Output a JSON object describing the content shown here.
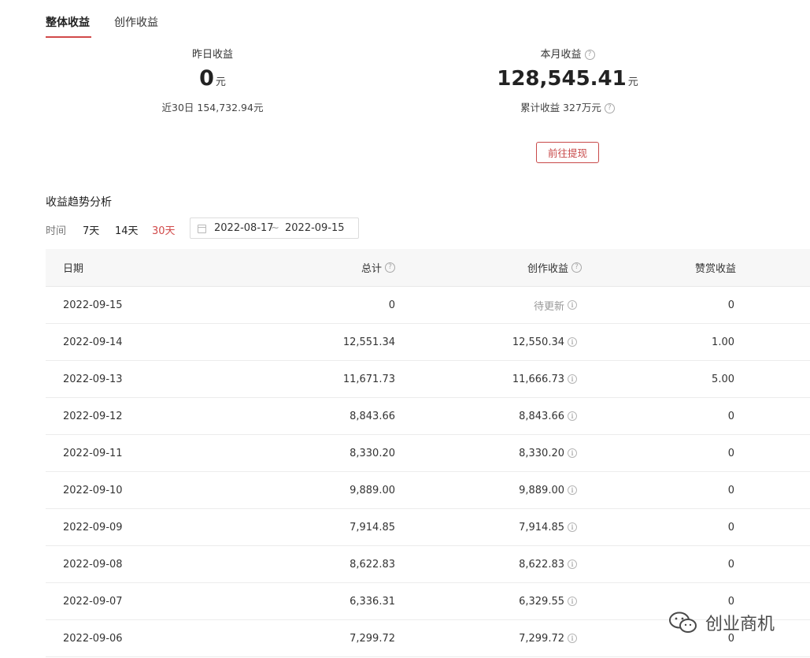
{
  "tabs": [
    {
      "label": "整体收益",
      "active": true
    },
    {
      "label": "创作收益",
      "active": false
    }
  ],
  "stats": {
    "yesterday": {
      "label": "昨日收益",
      "value": "0",
      "unit": "元",
      "sub": "近30日 154,732.94元"
    },
    "month": {
      "label": "本月收益",
      "value": "128,545.41",
      "unit": "元",
      "sub": "累计收益 327万元"
    }
  },
  "withdraw_label": "前往提现",
  "trend": {
    "title": "收益趋势分析",
    "filter_label": "时间",
    "ranges": [
      {
        "label": "7天",
        "active": false
      },
      {
        "label": "14天",
        "active": false
      },
      {
        "label": "30天",
        "active": true
      }
    ],
    "date_start": "2022-08-17",
    "date_sep": "~",
    "date_end": "2022-09-15"
  },
  "table": {
    "headers": {
      "date": "日期",
      "total": "总计",
      "create": "创作收益",
      "reward": "赞赏收益"
    },
    "rows": [
      {
        "date": "2022-09-15",
        "total": "0",
        "create": "待更新",
        "reward": "0",
        "pending": true
      },
      {
        "date": "2022-09-14",
        "total": "12,551.34",
        "create": "12,550.34",
        "reward": "1.00"
      },
      {
        "date": "2022-09-13",
        "total": "11,671.73",
        "create": "11,666.73",
        "reward": "5.00"
      },
      {
        "date": "2022-09-12",
        "total": "8,843.66",
        "create": "8,843.66",
        "reward": "0"
      },
      {
        "date": "2022-09-11",
        "total": "8,330.20",
        "create": "8,330.20",
        "reward": "0"
      },
      {
        "date": "2022-09-10",
        "total": "9,889.00",
        "create": "9,889.00",
        "reward": "0"
      },
      {
        "date": "2022-09-09",
        "total": "7,914.85",
        "create": "7,914.85",
        "reward": "0"
      },
      {
        "date": "2022-09-08",
        "total": "8,622.83",
        "create": "8,622.83",
        "reward": "0"
      },
      {
        "date": "2022-09-07",
        "total": "6,336.31",
        "create": "6,329.55",
        "reward": "0"
      },
      {
        "date": "2022-09-06",
        "total": "7,299.72",
        "create": "7,299.72",
        "reward": "0"
      }
    ]
  },
  "watermark": "创业商机",
  "colors": {
    "accent": "#d14a4a",
    "header_bg": "#f7f7f7",
    "border": "#ececec"
  }
}
